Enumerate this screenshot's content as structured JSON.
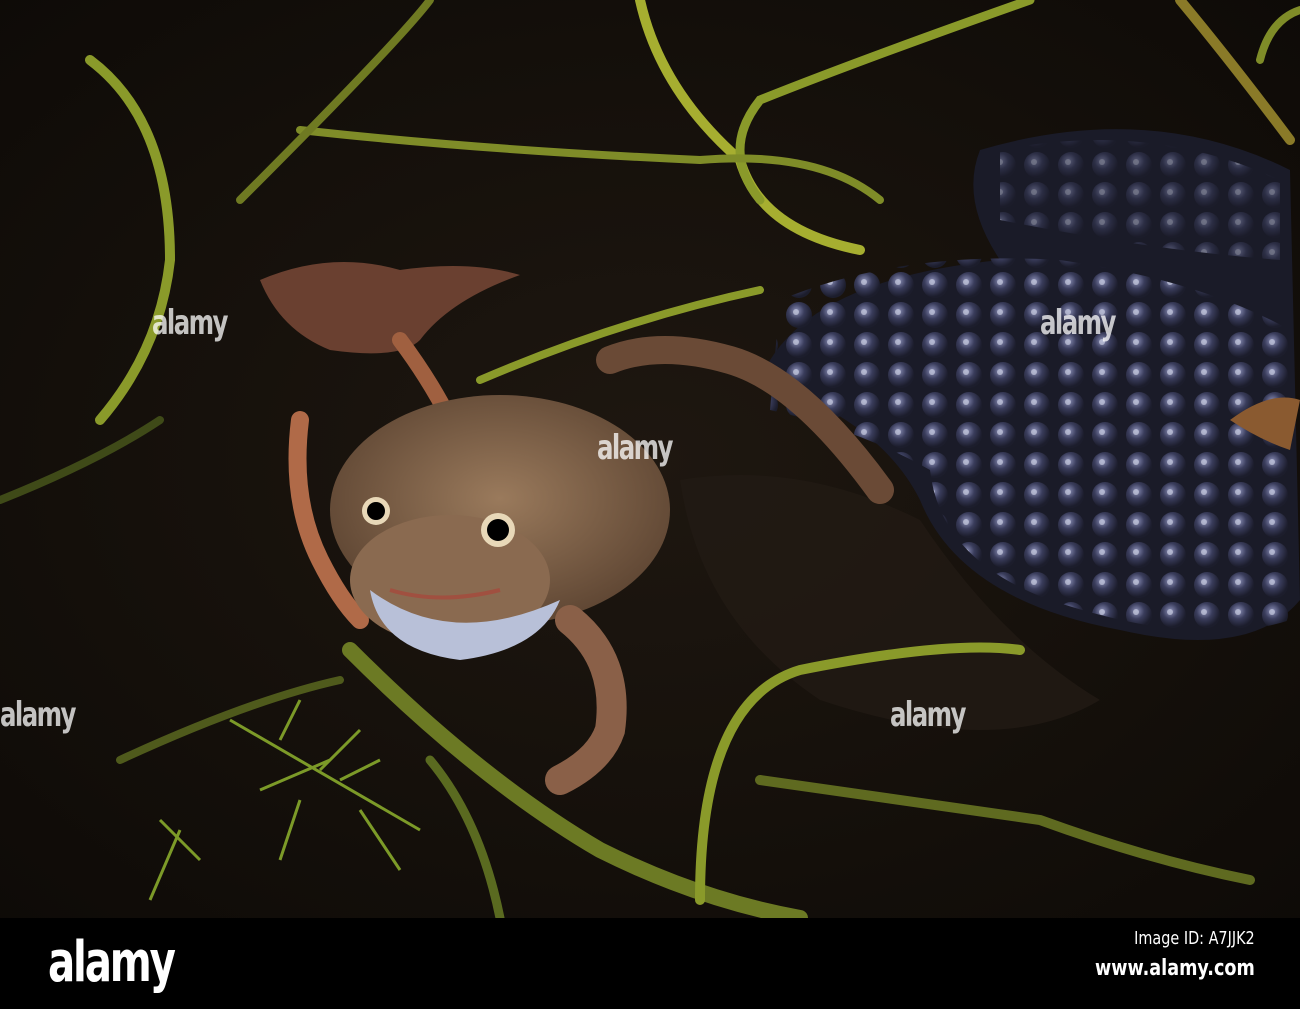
{
  "watermark_text": "alamy",
  "footer": {
    "logo": "alamy",
    "image_id": "Image ID: A7JJK2",
    "website": "www.alamy.com"
  },
  "colors": {
    "water": "#140f0a",
    "stem": "#8a9a2a",
    "frog": "#7a5a40",
    "spawn": "#2a2c40"
  }
}
